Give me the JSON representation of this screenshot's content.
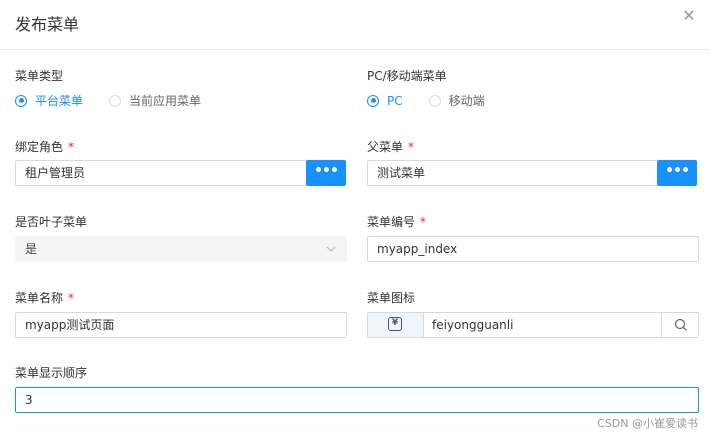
{
  "dialog": {
    "title": "发布菜单",
    "close_glyph": "✕"
  },
  "fields": {
    "menu_type": {
      "label": "菜单类型",
      "options": [
        {
          "label": "平台菜单",
          "checked": true
        },
        {
          "label": "当前应用菜单",
          "checked": false
        }
      ]
    },
    "platform_type": {
      "label": "PC/移动端菜单",
      "options": [
        {
          "label": "PC",
          "checked": true
        },
        {
          "label": "移动端",
          "checked": false
        }
      ]
    },
    "bind_role": {
      "label": "绑定角色",
      "required_mark": "*",
      "value": "租户管理员",
      "button_glyph": "•••"
    },
    "parent_menu": {
      "label": "父菜单",
      "required_mark": "*",
      "value": "测试菜单",
      "button_glyph": "•••"
    },
    "is_leaf": {
      "label": "是否叶子菜单",
      "value": "是"
    },
    "menu_code": {
      "label": "菜单编号",
      "required_mark": "*",
      "value": "myapp_index"
    },
    "menu_name": {
      "label": "菜单名称",
      "required_mark": "*",
      "value": "myapp测试页面"
    },
    "menu_icon": {
      "label": "菜单图标",
      "icon_glyph": "¥",
      "value": "feiyongguanli"
    },
    "display_order": {
      "label": "菜单显示顺序",
      "value": "3"
    }
  },
  "watermark": "CSDN @小崔爱读书",
  "colors": {
    "primary": "#1890ff",
    "required": "#f5222d",
    "focus_border": "#1a9cad"
  }
}
